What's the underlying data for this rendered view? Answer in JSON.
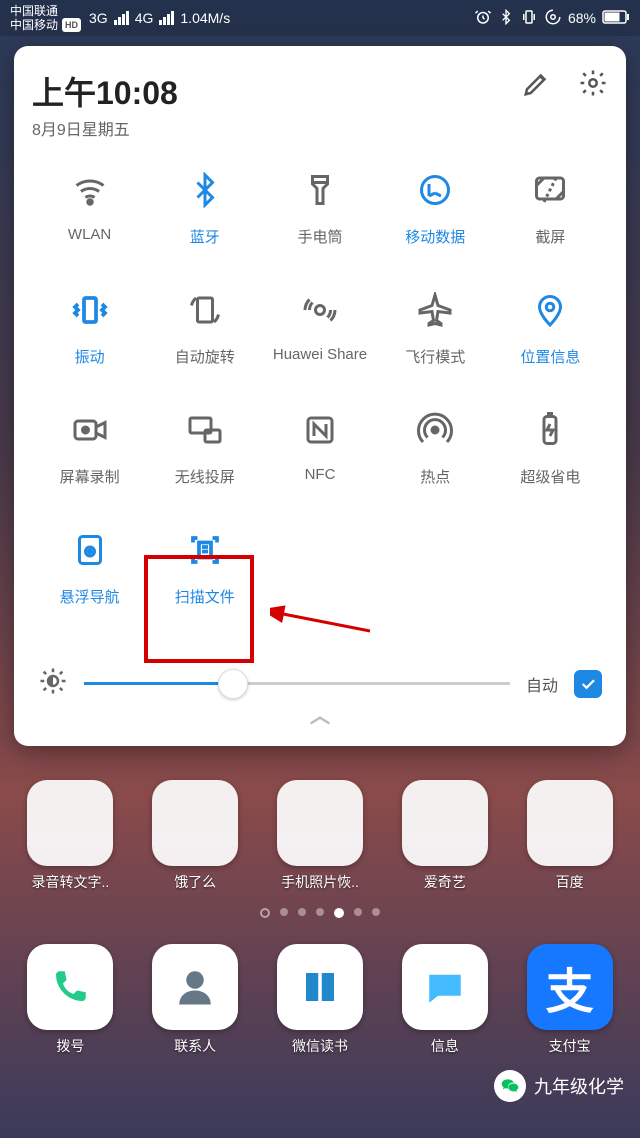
{
  "status_bar": {
    "carrier1": "中国联通",
    "carrier2": "中国移动",
    "hd": "HD",
    "net1": "3G",
    "net2": "4G",
    "speed": "1.04M/s",
    "battery_pct": "68%"
  },
  "panel": {
    "time": "上午10:08",
    "date": "8月9日星期五",
    "brightness": {
      "auto_label": "自动",
      "value_pct": 35
    }
  },
  "tiles": [
    {
      "id": "wlan",
      "label": "WLAN",
      "active": false
    },
    {
      "id": "bluetooth",
      "label": "蓝牙",
      "active": true
    },
    {
      "id": "flashlight",
      "label": "手电筒",
      "active": false
    },
    {
      "id": "mobile-data",
      "label": "移动数据",
      "active": true
    },
    {
      "id": "screenshot",
      "label": "截屏",
      "active": false
    },
    {
      "id": "vibrate",
      "label": "振动",
      "active": true
    },
    {
      "id": "auto-rotate",
      "label": "自动旋转",
      "active": false
    },
    {
      "id": "huawei-share",
      "label": "Huawei Share",
      "active": false
    },
    {
      "id": "airplane",
      "label": "飞行模式",
      "active": false
    },
    {
      "id": "location",
      "label": "位置信息",
      "active": true
    },
    {
      "id": "screen-record",
      "label": "屏幕录制",
      "active": false
    },
    {
      "id": "wireless-proj",
      "label": "无线投屏",
      "active": false
    },
    {
      "id": "nfc",
      "label": "NFC",
      "active": false
    },
    {
      "id": "hotspot",
      "label": "热点",
      "active": false
    },
    {
      "id": "power-save",
      "label": "超级省电",
      "active": false
    },
    {
      "id": "float-nav",
      "label": "悬浮导航",
      "active": true
    },
    {
      "id": "scan-doc",
      "label": "扫描文件",
      "active": true
    }
  ],
  "home_apps_row1": [
    {
      "id": "voice2text",
      "label": "录音转文字.."
    },
    {
      "id": "eleme",
      "label": "饿了么"
    },
    {
      "id": "photo-recover",
      "label": "手机照片恢.."
    },
    {
      "id": "iqiyi",
      "label": "爱奇艺"
    },
    {
      "id": "baidu",
      "label": "百度"
    }
  ],
  "dock_apps": [
    {
      "id": "dialer",
      "label": "拨号"
    },
    {
      "id": "contacts",
      "label": "联系人"
    },
    {
      "id": "weread",
      "label": "微信读书"
    },
    {
      "id": "messages",
      "label": "信息"
    },
    {
      "id": "alipay",
      "label": "支付宝"
    }
  ],
  "watermark": {
    "text": "九年级化学"
  }
}
